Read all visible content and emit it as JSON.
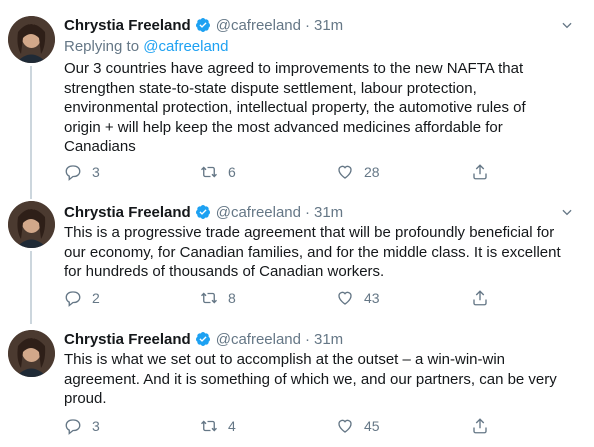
{
  "tweets": [
    {
      "author_name": "Chrystia Freeland",
      "handle": "@cafreeland",
      "dot": "·",
      "time": "31m",
      "reply_prefix": "Replying to ",
      "reply_mention": "@cafreeland",
      "text": "Our 3 countries have agreed to improvements to the new NAFTA that strengthen state-to-state dispute settlement, labour protection, environmental protection, intellectual property, the automotive rules of origin + will help keep the most advanced medicines affordable for Canadians",
      "replies": "3",
      "retweets": "6",
      "likes": "28"
    },
    {
      "author_name": "Chrystia Freeland",
      "handle": "@cafreeland",
      "dot": "·",
      "time": "31m",
      "text": "This is a progressive trade agreement that will be profoundly beneficial for our economy, for Canadian families, and for the middle class. It is excellent for hundreds of thousands of Canadian workers.",
      "replies": "2",
      "retweets": "8",
      "likes": "43"
    },
    {
      "author_name": "Chrystia Freeland",
      "handle": "@cafreeland",
      "dot": "·",
      "time": "31m",
      "text": "This is what we set out to accomplish at the outset – a win-win-win agreement. And it is something of which we, and our partners, can be very proud.",
      "replies": "3",
      "retweets": "4",
      "likes": "45"
    }
  ],
  "colors": {
    "accent": "#1da1f2",
    "muted": "#657786",
    "text": "#14171a"
  },
  "icons": [
    "verified-icon",
    "chevron-down-icon",
    "reply-icon",
    "retweet-icon",
    "like-icon",
    "share-icon"
  ]
}
